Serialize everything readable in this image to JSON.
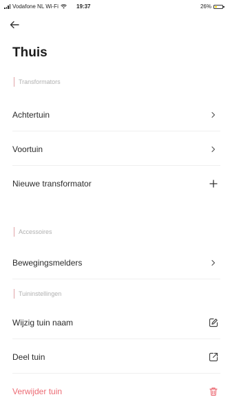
{
  "status_bar": {
    "carrier": "Vodafone NL Wi-Fi",
    "time": "19:37",
    "battery": "26%"
  },
  "nav": {
    "back_icon": "arrow-left-icon"
  },
  "page": {
    "title": "Thuis"
  },
  "sections": {
    "transformators": {
      "header": "Transformators",
      "items": [
        {
          "label": "Achtertuin",
          "icon": "chevron-right-icon"
        },
        {
          "label": "Voortuin",
          "icon": "chevron-right-icon"
        },
        {
          "label": "Nieuwe transformator",
          "icon": "plus-icon"
        }
      ]
    },
    "accessoires": {
      "header": "Accessoires",
      "items": [
        {
          "label": "Bewegingsmelders",
          "icon": "chevron-right-icon"
        }
      ]
    },
    "tuininstellingen": {
      "header": "Tuininstellingen",
      "items": [
        {
          "label": "Wijzig tuin naam",
          "icon": "edit-icon"
        },
        {
          "label": "Deel tuin",
          "icon": "share-icon"
        },
        {
          "label": "Verwijder tuin",
          "icon": "trash-icon"
        }
      ]
    }
  },
  "colors": {
    "accent": "#e0a3a6",
    "danger": "#ec6a73",
    "section_text": "#b0b0b0"
  }
}
